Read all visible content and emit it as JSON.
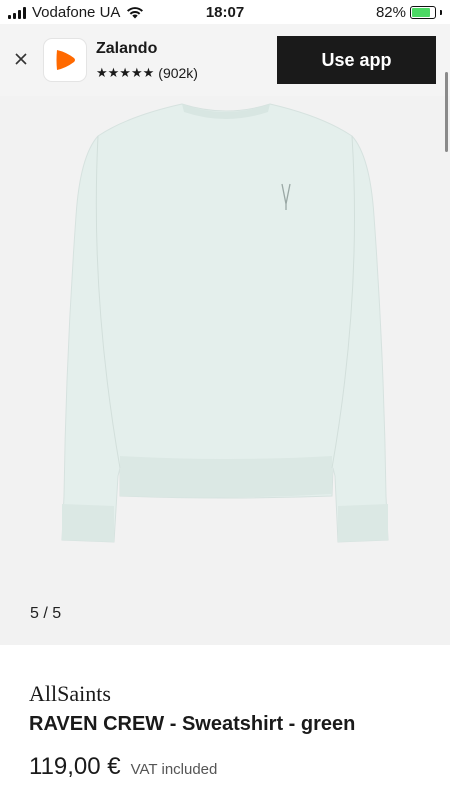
{
  "status_bar": {
    "carrier": "Vodafone UA",
    "time": "18:07",
    "battery_percent": "82%",
    "battery_level": 0.82,
    "battery_color": "#4cd964"
  },
  "app_banner": {
    "close_icon": "close-icon",
    "app_name": "Zalando",
    "stars": "★★★★★",
    "rating_count": "(902k)",
    "cta_label": "Use app",
    "brand_color": "#ff6900"
  },
  "gallery": {
    "counter": "5 / 5",
    "background": "#f2f2f2"
  },
  "product": {
    "brand": "AllSaints",
    "name": "RAVEN CREW - Sweatshirt - green",
    "price": "119,00 €",
    "vat_note": "VAT included"
  }
}
